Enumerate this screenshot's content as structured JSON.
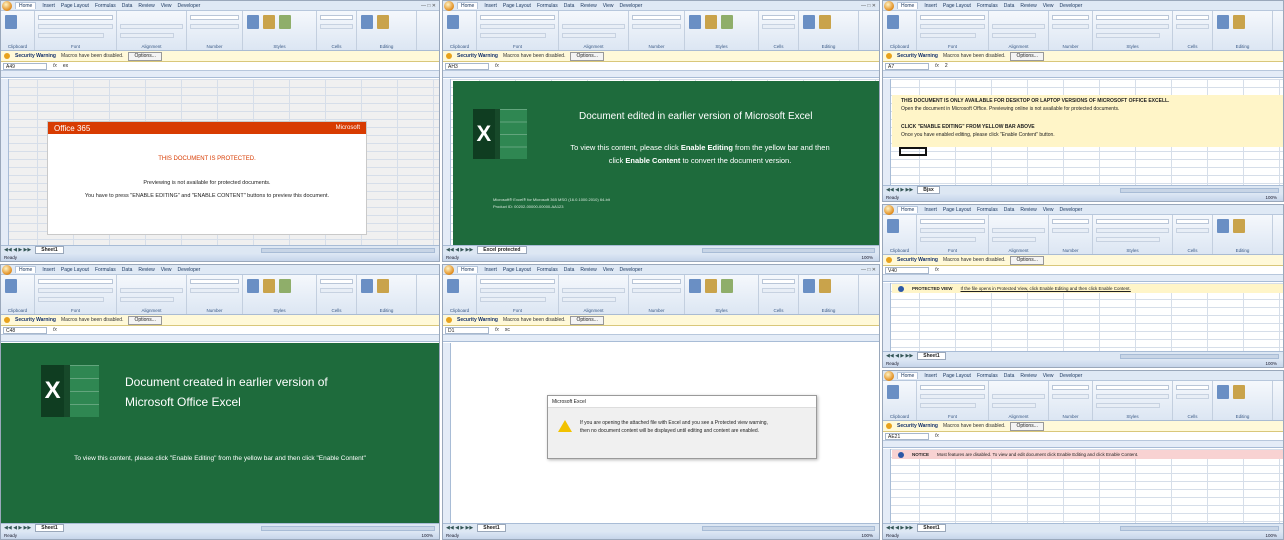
{
  "common": {
    "tabs": [
      "Home",
      "Insert",
      "Page Layout",
      "Formulas",
      "Data",
      "Review",
      "View",
      "Developer"
    ],
    "ribbon_groups": [
      "Clipboard",
      "Font",
      "Alignment",
      "Number",
      "Styles",
      "Cells",
      "Editing"
    ],
    "security_title": "Security Warning",
    "security_msg": "Macros have been disabled.",
    "options_label": "Options...",
    "fx": "fx",
    "ready": "Ready",
    "zoom": "100%"
  },
  "panes": {
    "p1": {
      "name_box": "A49",
      "formula": "ex",
      "sheet_tab": "Sheet1",
      "card": {
        "logo": "Office 365",
        "brand": "Microsoft",
        "protected": "THIS DOCUMENT IS PROTECTED.",
        "line1": "Previewing is not available for protected documents.",
        "line2": "You have to press \"ENABLE EDITING\" and \"ENABLE CONTENT\" buttons to preview this document."
      }
    },
    "p2": {
      "name_box": "AH3",
      "formula": "",
      "sheet_tab": "Excel protected",
      "title": "Document edited in earlier version of Microsoft Excel",
      "body_pre": "To view this content, please click ",
      "bold1": "Enable Editing",
      "body_mid": " from the yellow bar and then click ",
      "bold2": "Enable Content",
      "body_post": " to convert the document version.",
      "small1": "Microsoft® Excel® for Microsoft 365 MSO (16.0.1000.2010) 64-bit",
      "small2": "Product ID: 00202-00000-00000-AA123"
    },
    "p3": {
      "name_box": "A7",
      "formula": "2",
      "sheet_tab": "Bjsx",
      "line1": "THIS DOCUMENT IS ONLY AVAILABLE FOR DESKTOP OR LAPTOP VERSIONS OF MICROSOFT OFFICE EXCELL.",
      "line2": "Open the document in Microsoft Office. Previewing online is not available for protected documents.",
      "line3": "CLICK \"ENABLE EDITING\" FROM YELLOW BAR ABOVE",
      "line4": "Once you have enabled editing, please click \"Enable Content\" button."
    },
    "p4": {
      "name_box": "C48",
      "formula": "",
      "sheet_tab": "Sheet1",
      "title1": "Document created in earlier version of",
      "title2": "Microsoft Office Excel",
      "body": "To view this content,  please click \"Enable Editing\" from the yellow bar and then click \"Enable Content\""
    },
    "p5": {
      "name_box": "D1",
      "formula": "xc",
      "sheet_tab": "Sheet1",
      "dialog_title": "Microsoft Excel",
      "dialog_line1": "If you are opening the attached file with Excel and you see a Protected view warning,",
      "dialog_line2": "then no document content will be displayed until editing and content are enabled."
    },
    "p6": {
      "name_box": "V40",
      "formula": "",
      "sheet_tab": "Sheet1",
      "label": "PROTECTED VIEW",
      "msg": "If the file opens in Protected View, click Enable Editing and then click Enable Content."
    },
    "p7": {
      "name_box": "AE21",
      "formula": "",
      "sheet_tab": "Sheet1",
      "label": "NOTICE",
      "msg": "Most features are disabled. To view and edit document click Enable Editing and click Enable Content."
    }
  },
  "colors": {
    "excel_green": "#1e6b3c",
    "office_red": "#d83b01",
    "notice_pink": "#f8d2d2",
    "yellow": "#fff9d9"
  }
}
